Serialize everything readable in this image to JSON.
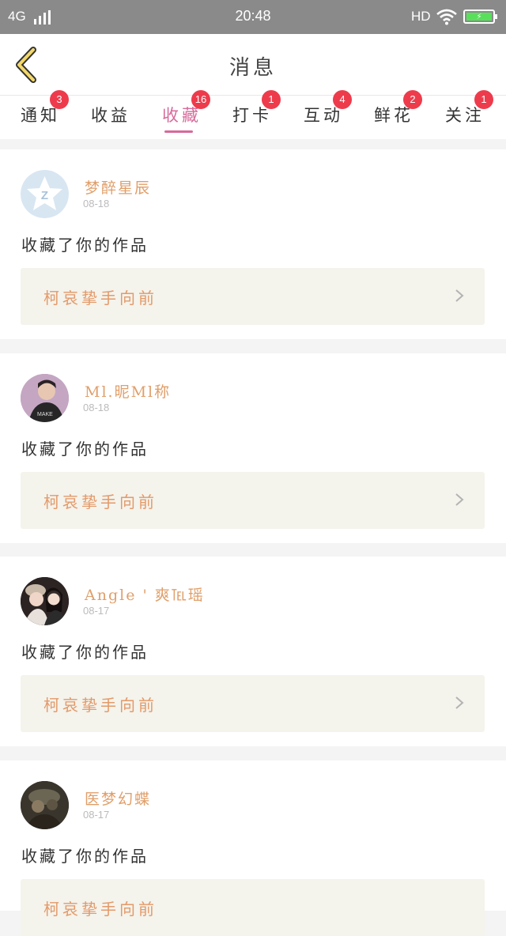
{
  "status_bar": {
    "network": "4G",
    "time": "20:48",
    "hd": "HD",
    "icons": [
      "signal-icon",
      "wifi-icon",
      "battery-charging-icon"
    ]
  },
  "header": {
    "title": "消息",
    "back_icon": "chevron-left-icon"
  },
  "tabs": [
    {
      "label": "通知",
      "badge": "3"
    },
    {
      "label": "收益",
      "badge": ""
    },
    {
      "label": "收藏",
      "badge": "16",
      "active": true
    },
    {
      "label": "打卡",
      "badge": "1"
    },
    {
      "label": "互动",
      "badge": "4"
    },
    {
      "label": "鲜花",
      "badge": "2"
    },
    {
      "label": "关注",
      "badge": "1"
    }
  ],
  "colors": {
    "accent_pink": "#d76a9a",
    "badge_red": "#ee3b4c",
    "username_orange": "#e09f6a",
    "work_title_orange": "#e39a6a",
    "back_arrow_yellow": "#f3d86a"
  },
  "messages": [
    {
      "username": "梦醉星辰",
      "date": "08-18",
      "action": "收藏了你的作品",
      "work_title": "柯哀挚手向前",
      "chevron_icon": "chevron-right-icon"
    },
    {
      "username": "Ml.昵Ml称",
      "date": "08-18",
      "action": "收藏了你的作品",
      "work_title": "柯哀挚手向前",
      "chevron_icon": "chevron-right-icon"
    },
    {
      "username": "Angle ' 爽℡瑶",
      "date": "08-17",
      "action": "收藏了你的作品",
      "work_title": "柯哀挚手向前",
      "chevron_icon": "chevron-right-icon"
    },
    {
      "username": "医梦幻蝶",
      "date": "08-17",
      "action": "收藏了你的作品",
      "work_title": "柯哀挚手向前",
      "chevron_icon": "chevron-right-icon"
    }
  ]
}
